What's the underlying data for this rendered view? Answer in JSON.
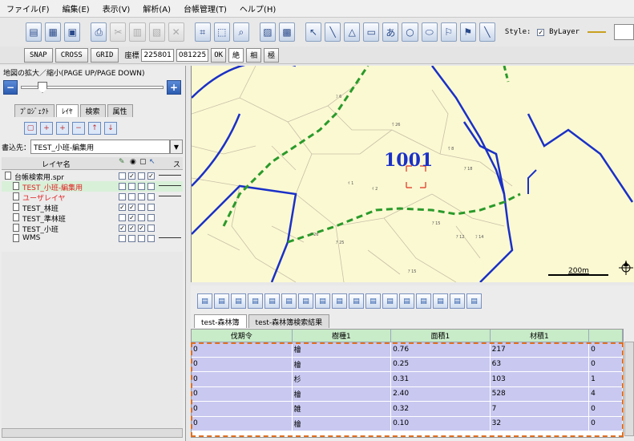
{
  "menu": [
    "ファイル(F)",
    "編集(E)",
    "表示(V)",
    "解析(A)",
    "台帳管理(T)",
    "ヘルプ(H)"
  ],
  "toolbar": {
    "style_label": "Style:",
    "bylayer": "ByLayer"
  },
  "toolbar2": {
    "snap": "SNAP",
    "cross": "CROSS",
    "grid": "GRID",
    "coord_label": "座標",
    "coord_x": "225801",
    "coord_y": "081225",
    "ok": "OK",
    "b1": "絶",
    "b2": "相",
    "b3": "極"
  },
  "left": {
    "zoom_label": "地図の拡大／縮小(PAGE UP/PAGE DOWN)",
    "tabs": [
      "ﾌﾟﾛｼﾞｪｸﾄ",
      "ﾚｲﾔ",
      "検索",
      "属性"
    ],
    "target_label": "書込先：",
    "target_value": "TEST_小班-編集用",
    "layer_header": "レイヤ名",
    "layer_header_s": "ス",
    "layers": [
      {
        "name": "台帳検索用.spr",
        "color": "#000"
      },
      {
        "name": "TEST_小班-編集用",
        "color": "#e02020"
      },
      {
        "name": "ユーザレイヤ",
        "color": "#e02020"
      },
      {
        "name": "TEST_林班",
        "color": "#000"
      },
      {
        "name": "TEST_準林班",
        "color": "#000"
      },
      {
        "name": "TEST_小班",
        "color": "#000"
      },
      {
        "name": "WMS",
        "color": "#000"
      }
    ]
  },
  "map": {
    "label_1001": "1001",
    "scale": "200m",
    "small_labels": [
      "ﾌ 6",
      "ｳ 26",
      "ｳ 8",
      "ｲ 1",
      "ｲ 2",
      "ｱ 15",
      "ｱ 12",
      "ｱ 26",
      "ｱ 25",
      "ｱ 15",
      "ﾌ 14",
      "ｱ 18"
    ]
  },
  "bottom": {
    "tabs": [
      "test-森林簿",
      "test-森林簿検索結果"
    ],
    "columns": [
      "伐期令",
      "樹種1",
      "面積1",
      "材積1"
    ],
    "rows": [
      [
        "0",
        "檜",
        "0.76",
        "217",
        "0"
      ],
      [
        "0",
        "檜",
        "0.25",
        "63",
        "0"
      ],
      [
        "0",
        "杉",
        "0.31",
        "103",
        "1"
      ],
      [
        "0",
        "檜",
        "2.40",
        "528",
        "4"
      ],
      [
        "0",
        "雑",
        "0.32",
        "7",
        "0"
      ],
      [
        "0",
        "檜",
        "0.10",
        "32",
        "0"
      ]
    ]
  }
}
